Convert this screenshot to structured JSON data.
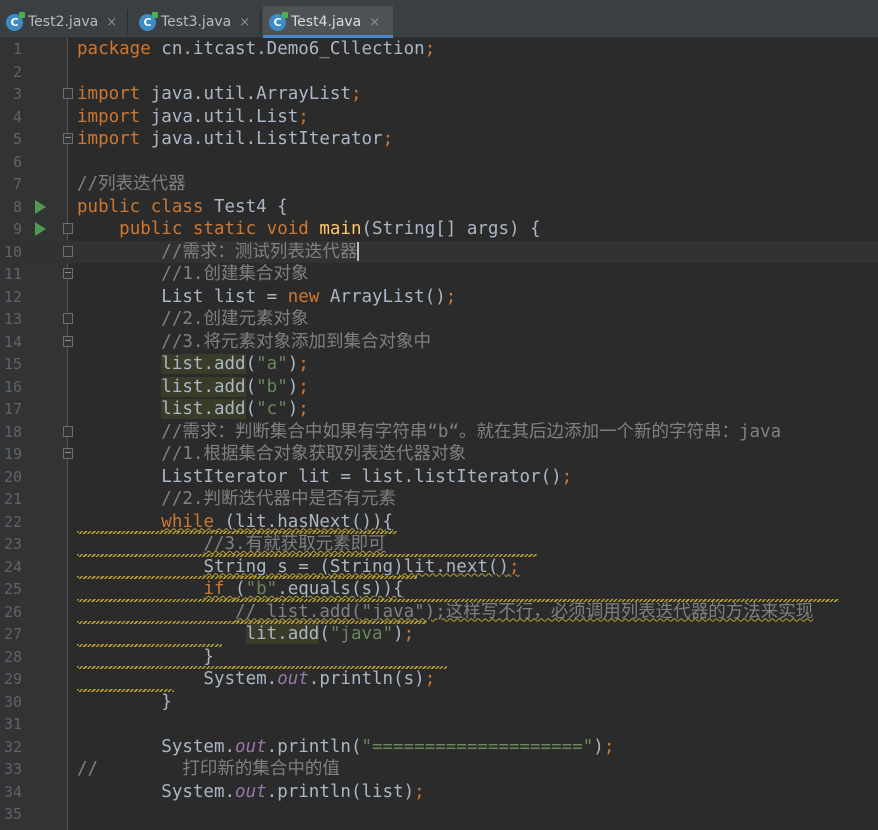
{
  "tabs": [
    {
      "label": "Test2.java",
      "active": false
    },
    {
      "label": "Test3.java",
      "active": false
    },
    {
      "label": "Test4.java",
      "active": true
    }
  ],
  "close_glyph": "×",
  "file_icon_letter": "C",
  "colors": {
    "keyword": "#cc7832",
    "string": "#6a8759",
    "comment": "#808080",
    "method": "#ffc66d",
    "field": "#9876aa",
    "text": "#a9b7c6",
    "accent": "#4a88c7"
  },
  "lines": [
    {
      "n": "1",
      "segs": [
        [
          "kw",
          "package "
        ],
        [
          "t",
          "cn.itcast.Demo6_Cllection"
        ],
        [
          "kw",
          ";"
        ]
      ]
    },
    {
      "n": "2",
      "segs": []
    },
    {
      "n": "3",
      "segs": [
        [
          "kw",
          "import "
        ],
        [
          "t",
          "java.util.ArrayList"
        ],
        [
          "kw",
          ";"
        ]
      ],
      "fold": "start"
    },
    {
      "n": "4",
      "segs": [
        [
          "kw",
          "import "
        ],
        [
          "t",
          "java.util.List"
        ],
        [
          "kw",
          ";"
        ]
      ]
    },
    {
      "n": "5",
      "segs": [
        [
          "kw",
          "import "
        ],
        [
          "t",
          "java.util.ListIterator"
        ],
        [
          "kw",
          ";"
        ]
      ],
      "fold": "end"
    },
    {
      "n": "6",
      "segs": []
    },
    {
      "n": "7",
      "segs": [
        [
          "cmt",
          "//列表迭代器"
        ]
      ]
    },
    {
      "n": "8",
      "segs": [
        [
          "kw",
          "public class "
        ],
        [
          "t",
          "Test4 {"
        ]
      ],
      "run": true
    },
    {
      "n": "9",
      "segs": [
        [
          "t",
          "    "
        ],
        [
          "kw",
          "public static void "
        ],
        [
          "method",
          "main"
        ],
        [
          "t",
          "(String[] args) {"
        ]
      ],
      "run": true,
      "fold": "start"
    },
    {
      "n": "10",
      "segs": [
        [
          "t",
          "        "
        ],
        [
          "cmt",
          "//需求：测试列表迭代器"
        ],
        [
          "caret",
          ""
        ]
      ],
      "fold": "start",
      "current": true
    },
    {
      "n": "11",
      "segs": [
        [
          "t",
          "        "
        ],
        [
          "cmt",
          "//1.创建集合对象"
        ]
      ],
      "fold": "end"
    },
    {
      "n": "12",
      "segs": [
        [
          "t",
          "        List list = "
        ],
        [
          "kw",
          "new "
        ],
        [
          "t",
          "ArrayList()"
        ],
        [
          "kw",
          ";"
        ]
      ]
    },
    {
      "n": "13",
      "segs": [
        [
          "t",
          "        "
        ],
        [
          "cmt",
          "//2.创建元素对象"
        ]
      ],
      "fold": "start"
    },
    {
      "n": "14",
      "segs": [
        [
          "t",
          "        "
        ],
        [
          "cmt",
          "//3.将元素对象添加到集合对象中"
        ]
      ],
      "fold": "end"
    },
    {
      "n": "15",
      "segs": [
        [
          "t",
          "        "
        ],
        [
          "hl",
          "list.add"
        ],
        [
          "t",
          "("
        ],
        [
          "str",
          "\"a\""
        ],
        [
          "t",
          ")"
        ],
        [
          "kw",
          ";"
        ]
      ]
    },
    {
      "n": "16",
      "segs": [
        [
          "t",
          "        "
        ],
        [
          "hl",
          "list.add"
        ],
        [
          "t",
          "("
        ],
        [
          "str",
          "\"b\""
        ],
        [
          "t",
          ")"
        ],
        [
          "kw",
          ";"
        ]
      ]
    },
    {
      "n": "17",
      "segs": [
        [
          "t",
          "        "
        ],
        [
          "hl",
          "list.add"
        ],
        [
          "t",
          "("
        ],
        [
          "str",
          "\"c\""
        ],
        [
          "t",
          ")"
        ],
        [
          "kw",
          ";"
        ]
      ]
    },
    {
      "n": "18",
      "segs": [
        [
          "t",
          "        "
        ],
        [
          "cmt",
          "//需求：判断集合中如果有字符串“b“。就在其后边添加一个新的字符串：java"
        ]
      ],
      "fold": "start"
    },
    {
      "n": "19",
      "segs": [
        [
          "t",
          "        "
        ],
        [
          "cmt",
          "//1.根据集合对象获取列表迭代器对象"
        ]
      ],
      "fold": "end"
    },
    {
      "n": "20",
      "segs": [
        [
          "t",
          "        ListIterator lit = list.listIterator()"
        ],
        [
          "kw",
          ";"
        ]
      ]
    },
    {
      "n": "21",
      "segs": [
        [
          "t",
          "        "
        ],
        [
          "cmt",
          "//2.判断迭代器中是否有元素"
        ]
      ]
    },
    {
      "n": "22",
      "segs": [
        [
          "t",
          "        "
        ],
        [
          "kwwarn",
          "while"
        ],
        [
          "wt",
          " (lit.hasNext()){"
        ]
      ]
    },
    {
      "n": "23",
      "segs": [
        [
          "t",
          "            "
        ],
        [
          "cmtwarn",
          "//3.有就获取元素即可"
        ]
      ],
      "wavy": 320
    },
    {
      "n": "24",
      "segs": [
        [
          "t",
          "            "
        ],
        [
          "wt",
          "String s = (String)lit.next()"
        ],
        [
          "kwwarn",
          ";"
        ]
      ],
      "wavy": 460
    },
    {
      "n": "25",
      "segs": [
        [
          "t",
          "            "
        ],
        [
          "kwwarn",
          "if "
        ],
        [
          "wt",
          "("
        ],
        [
          "strwarn",
          "\"b\""
        ],
        [
          "wt",
          ".equals(s)){"
        ]
      ],
      "wavy": 340
    },
    {
      "n": "26",
      "segs": [
        [
          "t",
          "               "
        ],
        [
          "cmtwarn",
          "// list.add(\"java\");这样写不行，必须调用列表迭代器的方法来实现"
        ]
      ],
      "wavy": 762
    },
    {
      "n": "27",
      "segs": [
        [
          "t",
          "                "
        ],
        [
          "hl",
          "lit.add"
        ],
        [
          "t",
          "("
        ],
        [
          "str",
          "\"java\""
        ],
        [
          "t",
          ")"
        ],
        [
          "kw",
          ";"
        ]
      ],
      "wavy": 350
    },
    {
      "n": "28",
      "segs": [
        [
          "t",
          "            }"
        ]
      ],
      "wavy": 145
    },
    {
      "n": "29",
      "segs": [
        [
          "t",
          "            System."
        ],
        [
          "field",
          "out"
        ],
        [
          "t",
          ".println(s)"
        ],
        [
          "kw",
          ";"
        ]
      ],
      "wavy": 370
    },
    {
      "n": "30",
      "segs": [
        [
          "t",
          "        }"
        ]
      ],
      "wavy": 97
    },
    {
      "n": "31",
      "segs": []
    },
    {
      "n": "32",
      "segs": [
        [
          "t",
          "        System."
        ],
        [
          "field",
          "out"
        ],
        [
          "t",
          ".println("
        ],
        [
          "str",
          "\"====================\""
        ],
        [
          "t",
          ")"
        ],
        [
          "kw",
          ";"
        ]
      ]
    },
    {
      "n": "33",
      "segs": [
        [
          "cmt",
          "//        打印新的集合中的值"
        ]
      ]
    },
    {
      "n": "34",
      "segs": [
        [
          "t",
          "        System."
        ],
        [
          "field",
          "out"
        ],
        [
          "t",
          ".println(list)"
        ],
        [
          "kw",
          ";"
        ]
      ]
    },
    {
      "n": "35",
      "segs": []
    }
  ]
}
